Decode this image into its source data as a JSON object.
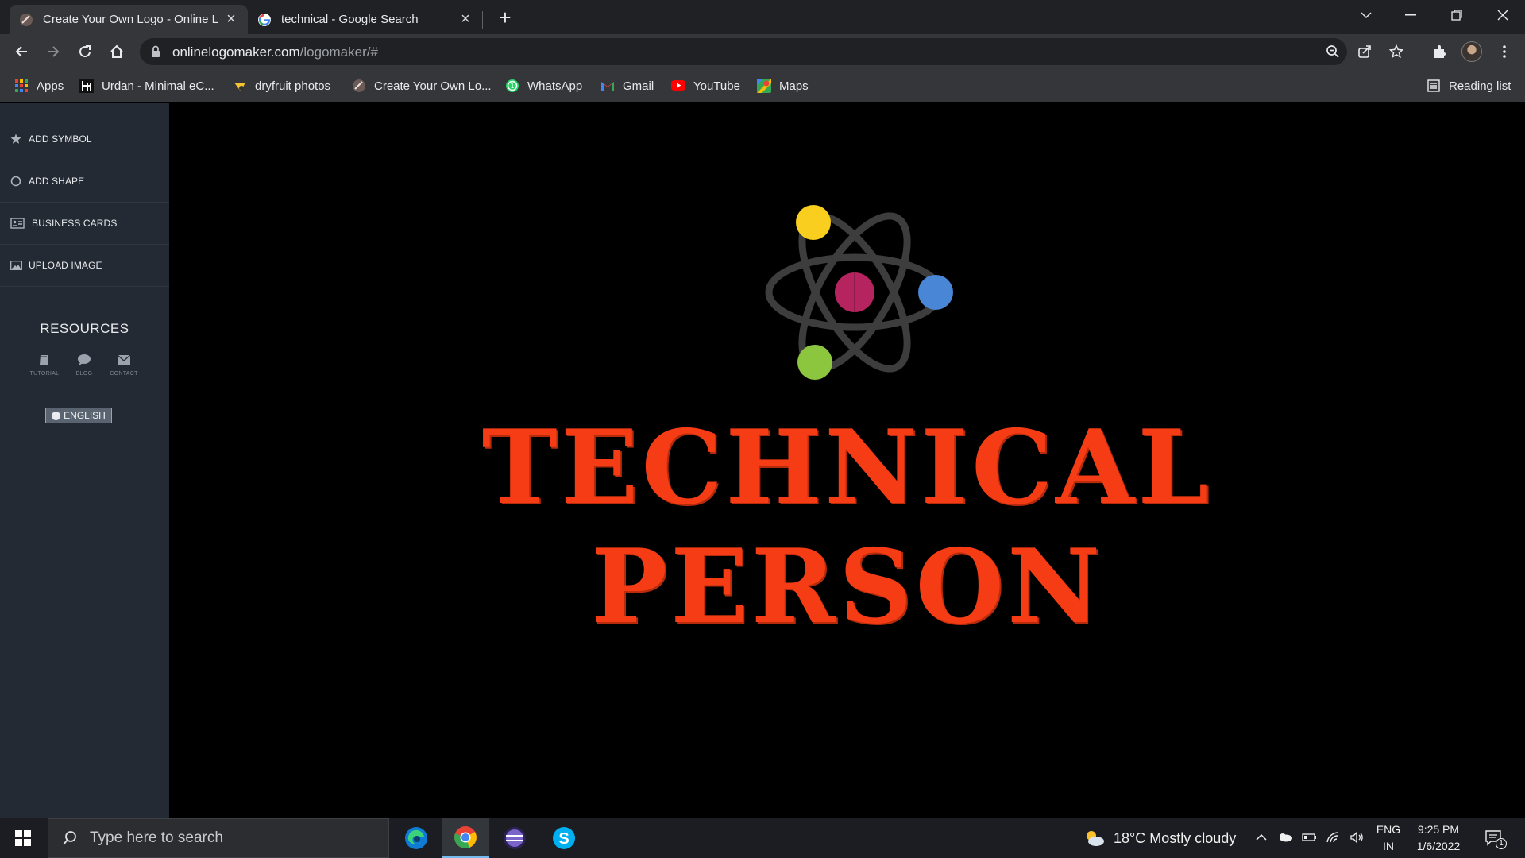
{
  "browser": {
    "tabs": [
      {
        "title": "Create Your Own Logo - Online L",
        "favicon": "logomaker-favicon",
        "active": true
      },
      {
        "title": "technical - Google Search",
        "favicon": "google-favicon",
        "active": false
      }
    ],
    "url_host": "onlinelogomaker.com",
    "url_path": "/logomaker/#",
    "bookmarks": [
      {
        "label": "Apps",
        "icon": "apps-grid-icon"
      },
      {
        "label": "Urdan - Minimal eC...",
        "icon": "urdan-icon"
      },
      {
        "label": "dryfruit photos",
        "icon": "dryfruit-icon"
      },
      {
        "label": "Create Your Own Lo...",
        "icon": "logomaker-favicon"
      },
      {
        "label": "WhatsApp",
        "icon": "whatsapp-icon"
      },
      {
        "label": "Gmail",
        "icon": "gmail-icon"
      },
      {
        "label": "YouTube",
        "icon": "youtube-icon"
      },
      {
        "label": "Maps",
        "icon": "maps-icon"
      }
    ],
    "reading_list": "Reading list"
  },
  "sidebar": {
    "items": [
      {
        "label": "ADD SYMBOL",
        "icon": "star-icon"
      },
      {
        "label": "ADD SHAPE",
        "icon": "circle-icon"
      },
      {
        "label": "BUSINESS CARDS",
        "icon": "business-card-icon"
      },
      {
        "label": "UPLOAD IMAGE",
        "icon": "image-icon"
      }
    ],
    "resources_title": "RESOURCES",
    "resources": [
      {
        "label": "TUTORIAL",
        "icon": "book-icon"
      },
      {
        "label": "BLOG",
        "icon": "chat-bubble-icon"
      },
      {
        "label": "CONTACT",
        "icon": "envelope-icon"
      }
    ],
    "language": "ENGLISH"
  },
  "canvas": {
    "line1": "TECHNICAL",
    "line2": "PERSON",
    "text_color": "#f53c14",
    "atom_colors": {
      "nucleus": "#b5245e",
      "electron_yellow": "#f9ce1e",
      "electron_blue": "#4a86d6",
      "electron_green": "#8cc63f",
      "orbit": "#3d3d3d"
    }
  },
  "taskbar": {
    "search_placeholder": "Type here to search",
    "apps": [
      "edge-icon",
      "chrome-icon",
      "eclipse-icon",
      "skype-icon"
    ],
    "weather": "18°C  Mostly cloudy",
    "lang_top": "ENG",
    "lang_bottom": "IN",
    "time": "9:25 PM",
    "date": "1/6/2022",
    "notification_count": "1"
  }
}
